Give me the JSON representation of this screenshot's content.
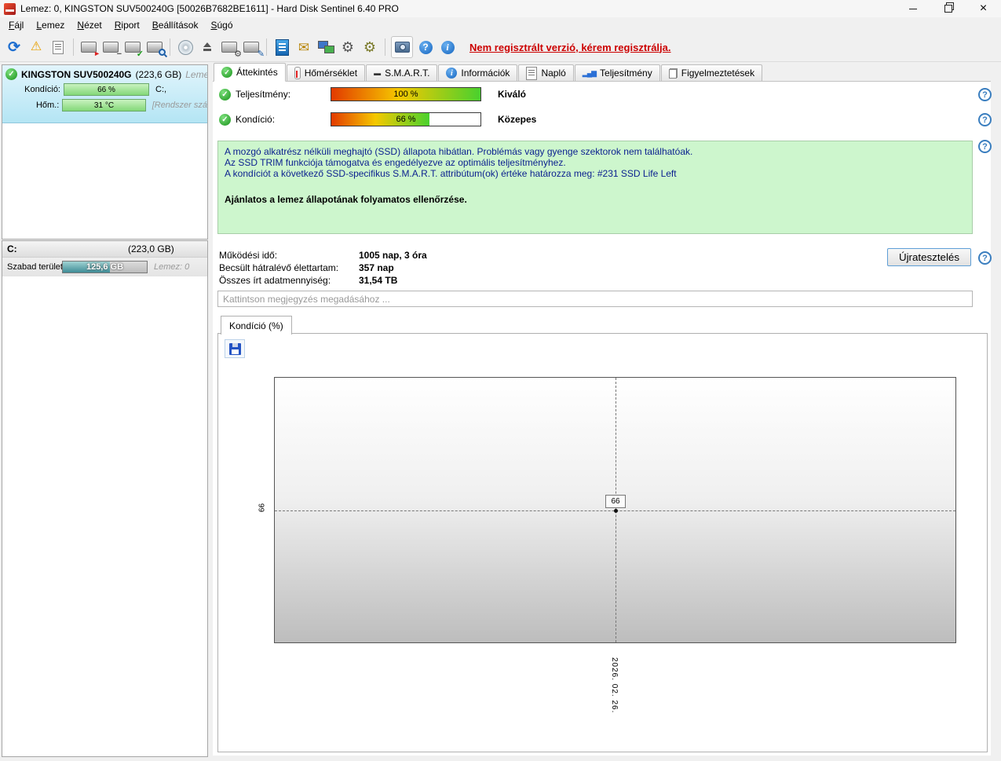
{
  "window": {
    "title": "Lemez: 0, KINGSTON SUV500240G [50026B7682BE1611]  -  Hard Disk Sentinel 6.40 PRO"
  },
  "menu": {
    "items": [
      "Fájl",
      "Lemez",
      "Nézet",
      "Riport",
      "Beállítások",
      "Súgó"
    ]
  },
  "toolbar": {
    "register_notice": "Nem regisztrált verzió, kérem regisztrálja."
  },
  "icons": {
    "refresh": "⟳",
    "warning": "⚠",
    "mail": "✉",
    "gear": "⚙",
    "help": "?",
    "info": "i",
    "smart": "▬",
    "chart_bars": "▂▄▆",
    "check": "✓"
  },
  "sidebar": {
    "disk": {
      "name": "KINGSTON SUV500240G",
      "size": "(223,6 GB)",
      "suffix": "Lemez:",
      "condition_label": "Kondíció:",
      "condition_value": "66 %",
      "condition_extra": "C:,",
      "temp_label": "Hőm.:",
      "temp_value": "31 °C",
      "temp_extra": "[Rendszer szá"
    },
    "partition": {
      "drive": "C:",
      "size": "(223,0 GB)",
      "free_label": "Szabad terület",
      "free_value": "125,6 GB",
      "free_percent": 56,
      "disk_ref": "Lemez: 0"
    }
  },
  "tabs": {
    "items": [
      "Áttekintés",
      "Hőmérséklet",
      "S.M.A.R.T.",
      "Információk",
      "Napló",
      "Teljesítmény",
      "Figyelmeztetések"
    ]
  },
  "overview": {
    "performance": {
      "label": "Teljesítmény:",
      "value": "100 %",
      "percent": 100,
      "rating": "Kiváló"
    },
    "condition": {
      "label": "Kondíció:",
      "value": "66 %",
      "percent": 66,
      "rating": "Közepes"
    },
    "status": {
      "line1": "A mozgó alkatrész nélküli meghajtó (SSD) állapota hibátlan. Problémás vagy gyenge szektorok nem találhatóak.",
      "line2": "Az SSD TRIM funkciója támogatva és engedélyezve az optimális teljesítményhez.",
      "line3": "A kondíciót a következő SSD-specifikus S.M.A.R.T. attribútum(ok) értéke határozza meg:  #231 SSD Life Left",
      "advice": "Ajánlatos a lemez állapotának folyamatos ellenőrzése."
    },
    "info": [
      {
        "label": "Működési idő:",
        "value": "1005 nap, 3 óra"
      },
      {
        "label": "Becsült hátralévő élettartam:",
        "value": "357 nap"
      },
      {
        "label": "Összes írt adatmennyiség:",
        "value": "31,54 TB"
      }
    ],
    "retest_button": "Újratesztelés",
    "comment_placeholder": "Kattintson megjegyzés megadásához ..."
  },
  "chart": {
    "tab_label": "Kondíció  (%)",
    "chart_data": {
      "type": "line",
      "title": "Kondíció (%)",
      "x": [
        "2026. 02. 26."
      ],
      "series": [
        {
          "name": "Kondíció",
          "values": [
            66
          ]
        }
      ],
      "ylim": [
        0,
        100
      ],
      "y_tick_label": "66",
      "point_label": "66",
      "grid": "dashed-crosshair",
      "legend": "none"
    }
  }
}
